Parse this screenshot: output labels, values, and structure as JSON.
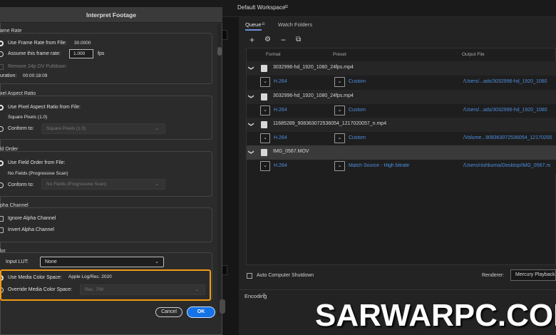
{
  "app": {
    "workspace_label": "Default Workspace",
    "menu_icon": "≡",
    "tabs": {
      "queue": "Queue",
      "watch_folders": "Watch Folders"
    },
    "toolbar": {
      "add": "+",
      "settings": "⚙",
      "remove": "−",
      "duplicate": "⧉"
    },
    "columns": {
      "format": "Format",
      "preset": "Preset",
      "output_file": "Output File"
    },
    "queue_items": [
      {
        "name": "3032996-hd_1920_1080_24fps.mp4",
        "format": "H.264",
        "preset": "Custom",
        "output": "/Users/...ads/3032996-hd_1920_1080"
      },
      {
        "name": "3032996-hd_1920_1080_24fps.mp4",
        "format": "H.264",
        "preset": "Custom",
        "output": "/Users/...ads/3032996-hd_1920_1080"
      },
      {
        "name": "11685289_908363072536054_1217020057_n.mp4",
        "format": "H.264",
        "preset": "Custom",
        "output": "/Volume...908363072536054_12170200"
      },
      {
        "name": "IMG_0567.MOV",
        "format": "H.264",
        "preset": "Match Source - High bitrate",
        "output": "/Users/nishkuma/Desktop/IMG_0567.m"
      }
    ],
    "auto_shutdown": "Auto Computer Shutdown",
    "renderer_label": "Renderer:",
    "renderer_value": "Mercury Playback",
    "encoding_tab": "Encoding",
    "watermark": "SARWARPC.COM"
  },
  "dialog": {
    "title": "Interpret Footage",
    "frame_rate": {
      "section": "ame Rate",
      "use_from_file": "Use Frame Rate from File:",
      "file_value": "30.0000",
      "assume": "Assume this frame rate:",
      "assume_value": "1.000",
      "fps": "fps",
      "remove_pulldown": "Remove 24p DV Pulldown",
      "duration_label": "uration:",
      "duration_value": "00:00:18:09"
    },
    "pixel_aspect": {
      "section": "xel Aspect Ratio",
      "use_from_file": "Use Pixel Aspect Ratio from File:",
      "file_value": "Square Pixels (1.0)",
      "conform": "Conform to:",
      "conform_value": "Square Pixels (1.0)"
    },
    "field_order": {
      "section": "ld Order",
      "use_from_file": "Use Field Order from File:",
      "file_value": "No Fields (Progressive Scan)",
      "conform": "Conform to:",
      "conform_value": "No Fields (Progressive Scan)"
    },
    "alpha": {
      "section": "pha Channel",
      "ignore": "Ignore Alpha Channel",
      "invert": "Invert Alpha Channel"
    },
    "color": {
      "section": "lor",
      "input_lut": "Input LUT:",
      "input_lut_value": "None",
      "use_media": "Use Media Color Space:",
      "use_media_value": "Apple Log/Rec. 2020",
      "override": "Override Media Color Space:",
      "override_value": "Rec. 709"
    },
    "cancel": "Cancel",
    "ok": "OK"
  },
  "colors": {
    "accent_blue": "#1473e6",
    "highlight_orange": "#f29b12",
    "link_blue": "#4d8fe0"
  }
}
